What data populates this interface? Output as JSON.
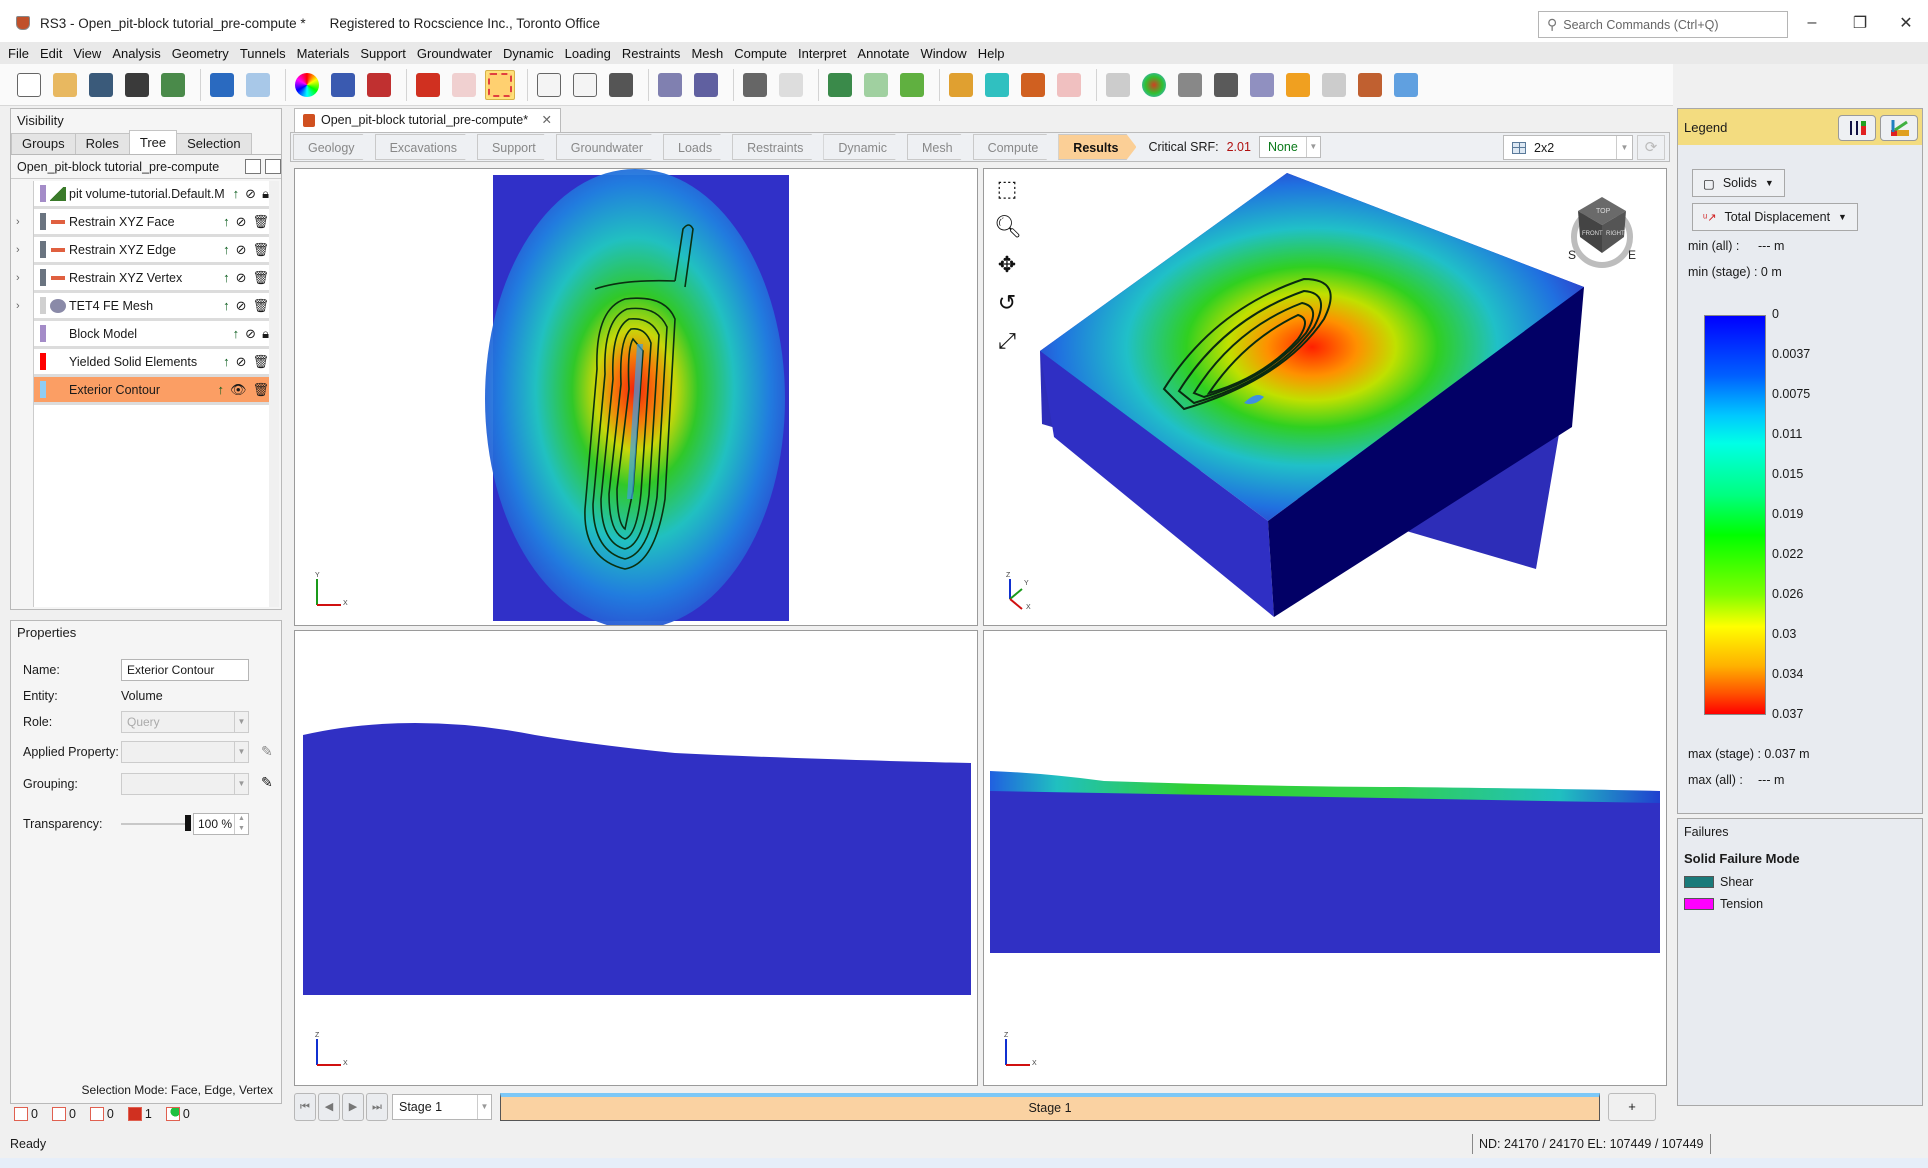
{
  "window": {
    "title": "RS3 - Open_pit-block tutorial_pre-compute *",
    "registration": "Registered to Rocscience Inc., Toronto Office",
    "search_placeholder": "Search Commands (Ctrl+Q)",
    "controls": {
      "minimize": "–",
      "restore": "❐",
      "close": "✕"
    }
  },
  "menu": [
    "File",
    "Edit",
    "View",
    "Analysis",
    "Geometry",
    "Tunnels",
    "Materials",
    "Support",
    "Groundwater",
    "Dynamic",
    "Loading",
    "Restraints",
    "Mesh",
    "Compute",
    "Interpret",
    "Annotate",
    "Window",
    "Help"
  ],
  "toolbar": {
    "icons": [
      "new-file",
      "open-folder",
      "save",
      "print",
      "report",
      "undo",
      "redo",
      "color-wheel",
      "image-export",
      "edit-tool",
      "solid-red",
      "wireframe-box",
      "select-box",
      "lock-selection",
      "deselect",
      "polyline-tool",
      "shapes",
      "import-surface",
      "copy-docs",
      "chart-export",
      "view-toggle",
      "box-green",
      "box-colored",
      "box-rainbow",
      "box-cyan",
      "building-chart",
      "box-red-outline",
      "box-gray",
      "contour-blob",
      "query-point",
      "tunnel",
      "shell",
      "filter",
      "graph",
      "import-block",
      "import-points"
    ],
    "selected": "select-box"
  },
  "visibility": {
    "header": "Visibility",
    "tabs": [
      "Groups",
      "Roles",
      "Tree",
      "Selection"
    ],
    "active_tab": "Tree",
    "model_name": "Open_pit-block tutorial_pre-compute",
    "items": [
      {
        "label": "pit volume-tutorial.Default.M",
        "swatch": "#a48cc8",
        "icon": "terrain-icon",
        "expandable": false,
        "visible": false,
        "locked": true,
        "selected": false
      },
      {
        "label": "Restrain XYZ Face",
        "swatch": "#6a7480",
        "icon": "restraint-icon",
        "expandable": true,
        "visible": false,
        "locked": false,
        "selected": false
      },
      {
        "label": "Restrain XYZ Edge",
        "swatch": "#6a7480",
        "icon": "restraint-icon",
        "expandable": true,
        "visible": false,
        "locked": false,
        "selected": false
      },
      {
        "label": "Restrain XYZ Vertex",
        "swatch": "#6a7480",
        "icon": "restraint-icon",
        "expandable": true,
        "visible": false,
        "locked": false,
        "selected": false
      },
      {
        "label": "TET4 FE Mesh",
        "swatch": "#d0d0d0",
        "icon": "mesh-icon",
        "expandable": true,
        "visible": false,
        "locked": false,
        "selected": false
      },
      {
        "label": "Block Model",
        "swatch": "#a48cc8",
        "icon": "",
        "expandable": false,
        "visible": false,
        "locked": true,
        "selected": false
      },
      {
        "label": "Yielded Solid Elements",
        "swatch": "#ff0000",
        "icon": "",
        "expandable": false,
        "visible": false,
        "locked": false,
        "selected": false
      },
      {
        "label": "Exterior Contour",
        "swatch": "#8fcdf5",
        "icon": "",
        "expandable": false,
        "visible": true,
        "locked": false,
        "selected": true
      }
    ]
  },
  "properties": {
    "header": "Properties",
    "name_label": "Name:",
    "name_value": "Exterior Contour",
    "entity_label": "Entity:",
    "entity_value": "Volume",
    "role_label": "Role:",
    "role_value": "Query",
    "applied_label": "Applied Property:",
    "applied_value": "",
    "grouping_label": "Grouping:",
    "grouping_value": "",
    "transparency_label": "Transparency:",
    "transparency_value": "100 %",
    "transparency_fraction": 1.0,
    "selection_mode": "Selection Mode: Face, Edge, Vertex"
  },
  "selection_counts": [
    {
      "type": "vertex",
      "count": "0"
    },
    {
      "type": "edge",
      "count": "0"
    },
    {
      "type": "face",
      "count": "0"
    },
    {
      "type": "volume",
      "count": "1"
    },
    {
      "type": "other",
      "count": "0"
    }
  ],
  "document": {
    "tab_label": "Open_pit-block tutorial_pre-compute*",
    "workflow": [
      "Geology",
      "Excavations",
      "Support",
      "Groundwater",
      "Loads",
      "Restraints",
      "Dynamic",
      "Mesh",
      "Compute",
      "Results"
    ],
    "active_step": "Results",
    "critical_srf_label": "Critical SRF:",
    "critical_srf_value": "2.01",
    "srf_option": "None",
    "layout": "2x2"
  },
  "viewports": [
    {
      "view": "top",
      "axes": [
        "Y",
        "X"
      ]
    },
    {
      "view": "perspective",
      "axes": [
        "Z",
        "Y",
        "X"
      ],
      "navcube": {
        "faces": [
          "TOP",
          "FRONT",
          "RIGHT"
        ],
        "compass": [
          "S",
          "E"
        ]
      }
    },
    {
      "view": "front",
      "axes": [
        "Z",
        "X"
      ]
    },
    {
      "view": "front-section",
      "axes": [
        "Z",
        "X"
      ]
    }
  ],
  "stage": {
    "selected": "Stage 1",
    "band_label": "Stage 1",
    "add_label": "+"
  },
  "legend": {
    "header": "Legend",
    "entity": "Solids",
    "quantity": "Total Displacement",
    "min_all": "min (all) :",
    "min_all_value": "--- m",
    "min_stage": "min (stage) : 0 m",
    "ticks": [
      "0",
      "0.0037",
      "0.0075",
      "0.011",
      "0.015",
      "0.019",
      "0.022",
      "0.026",
      "0.03",
      "0.034",
      "0.037"
    ],
    "max_stage": "max (stage) : 0.037 m",
    "max_all": "max (all) :",
    "max_all_value": "--- m"
  },
  "failures": {
    "header": "Failures",
    "title": "Solid Failure Mode",
    "items": [
      {
        "label": "Shear",
        "color": "#1a7a7a"
      },
      {
        "label": "Tension",
        "color": "#ff00ff"
      }
    ]
  },
  "status": {
    "ready": "Ready",
    "counts": "ND: 24170 / 24170  EL: 107449 / 107449"
  }
}
